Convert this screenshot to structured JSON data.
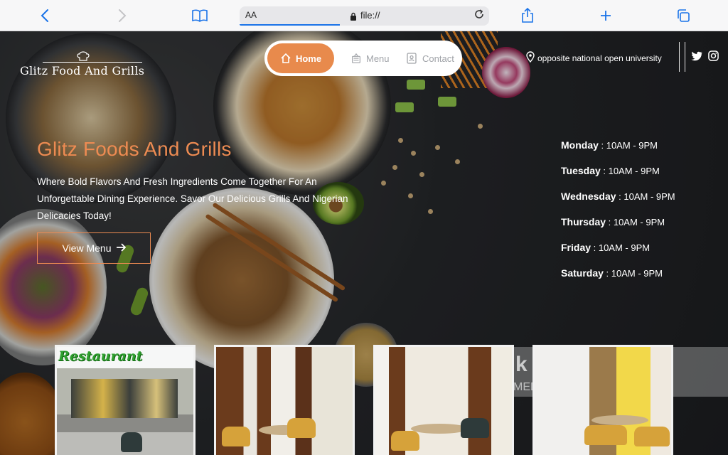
{
  "browser": {
    "text_size_label": "AA",
    "url": "file://"
  },
  "header": {
    "logo_text": "Glitz Food And Grills",
    "nav": [
      {
        "label": "Home",
        "active": true
      },
      {
        "label": "Menu",
        "active": false
      },
      {
        "label": "Contact",
        "active": false
      }
    ],
    "location": "opposite national open university"
  },
  "hero": {
    "title": "Glitz Foods And Grills",
    "description": "Where Bold Flavors And Fresh Ingredients Come Together For An Unforgettable Dining Experience. Savor Our Delicious Grills And Nigerian Delicacies Today!",
    "cta_label": "View Menu"
  },
  "hours": [
    {
      "day": "Monday",
      "time": " : 10AM - 9PM"
    },
    {
      "day": "Tuesday",
      "time": " : 10AM - 9PM"
    },
    {
      "day": "Wednesday",
      "time": " : 10AM - 9PM"
    },
    {
      "day": "Thursday",
      "time": " : 10AM - 9PM"
    },
    {
      "day": "Friday",
      "time": " : 10AM - 9PM"
    },
    {
      "day": "Saturday",
      "time": " : 10AM - 9PM"
    }
  ],
  "gallery": {
    "sign_text": "Restaurant"
  },
  "watermark": {
    "text": "k",
    "sub": "MED"
  },
  "colors": {
    "accent": "#ed8b52",
    "nav_active": "#e88a4c",
    "browser_blue": "#1a73e8"
  }
}
